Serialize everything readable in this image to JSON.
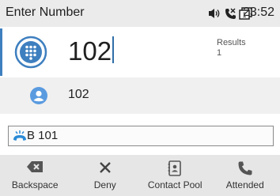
{
  "status_bar": {
    "title": "Enter Number",
    "time": "23:52",
    "icons": [
      "speaker-icon",
      "missed-call-icon",
      "notification-count-icon"
    ],
    "notification_count": "1"
  },
  "entry": {
    "icon": "dialpad-icon",
    "number": "102",
    "results_label": "Results",
    "results_count": "1"
  },
  "results": [
    {
      "icon": "contact-avatar-icon",
      "name": "102"
    }
  ],
  "line": {
    "icon": "line-status-icon",
    "label": "B 101"
  },
  "softkeys": [
    {
      "label": "Backspace",
      "icon": "backspace-icon"
    },
    {
      "label": "Deny",
      "icon": "close-icon"
    },
    {
      "label": "Contact Pool",
      "icon": "contact-pool-icon"
    },
    {
      "label": "Attended",
      "icon": "phone-icon"
    }
  ],
  "colors": {
    "accent": "#3e7fbf",
    "avatar": "#5a9be0",
    "line_icon": "#2a8ad6",
    "status_bg": "#ebebeb",
    "softkey_bg": "#e6e6e6"
  }
}
